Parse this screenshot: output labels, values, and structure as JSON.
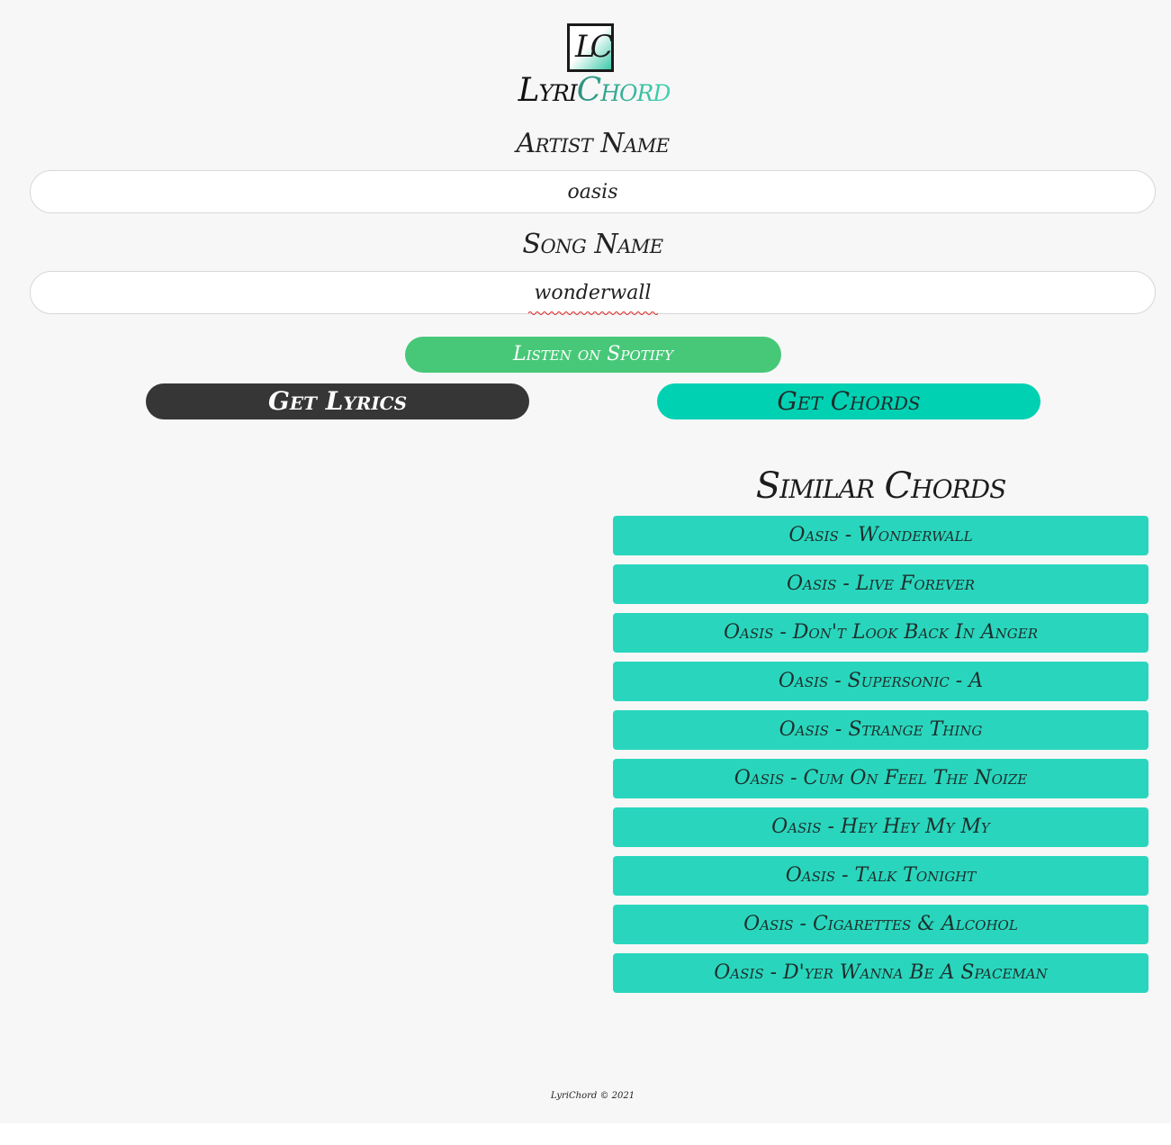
{
  "logo": {
    "mark_text": "LC",
    "name_part1": "Lyri",
    "name_part2": "Chord"
  },
  "form": {
    "artist_label": "Artist Name",
    "artist_value": "oasis",
    "song_label": "Song Name",
    "song_value": "wonderwall"
  },
  "buttons": {
    "spotify_label": "Listen on Spotify",
    "lyrics_label": "Get Lyrics",
    "chords_label": "Get Chords"
  },
  "similar": {
    "title": "Similar Chords",
    "items": [
      "Oasis - Wonderwall",
      "Oasis - Live Forever",
      "Oasis - Don't Look Back In Anger",
      "Oasis - Supersonic - A",
      "Oasis - Strange Thing",
      "Oasis - Cum On Feel The Noize",
      "Oasis - Hey Hey My My",
      "Oasis - Talk Tonight",
      "Oasis - Cigarettes & Alcohol",
      "Oasis - D'yer Wanna Be A Spaceman"
    ]
  },
  "footer": {
    "text": "LyriChord © 2021"
  },
  "colors": {
    "page_bg": "#f7f7f7",
    "spotify_green": "#47c878",
    "lyrics_dark": "#363636",
    "chords_teal": "#00d1b2",
    "similar_item_teal": "#29d6bd"
  },
  "icons": {
    "logo": "lyrichord-logo-icon"
  }
}
